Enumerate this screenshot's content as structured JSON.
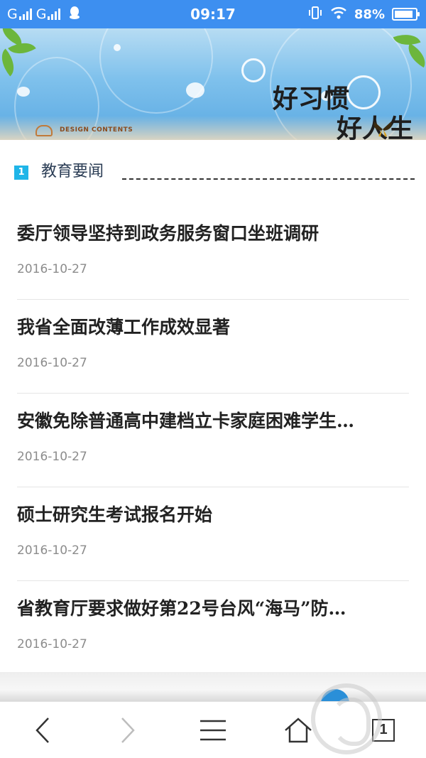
{
  "status_bar": {
    "carrier1": "G",
    "carrier2": "G",
    "time": "09:17",
    "battery": "88%",
    "battery_level": 0.88,
    "icons": [
      "signal-icon",
      "signal-icon",
      "qq-notification-icon",
      "vibrate-icon",
      "wifi-icon",
      "battery-icon"
    ]
  },
  "banner": {
    "slogan_line1": "好习惯",
    "slogan_line2": "好人生",
    "design_text": "DESIGN CONTENTS"
  },
  "section": {
    "number": "1",
    "title": "教育要闻"
  },
  "news": [
    {
      "title": "委厅领导坚持到政务服务窗口坐班调研",
      "date": "2016-10-27"
    },
    {
      "title": "我省全面改薄工作成效显著",
      "date": "2016-10-27"
    },
    {
      "title": "安徽免除普通高中建档立卡家庭困难学生…",
      "date": "2016-10-27"
    },
    {
      "title": "硕士研究生考试报名开始",
      "date": "2016-10-27"
    },
    {
      "title": "省教育厅要求做好第22号台风“海马”防…",
      "date": "2016-10-27"
    }
  ],
  "nav": {
    "tab_count": "1",
    "icons": [
      "back-arrow-icon",
      "forward-arrow-icon",
      "menu-icon",
      "home-icon",
      "tabs-icon"
    ]
  },
  "colors": {
    "status_bar": "#3d8ff0",
    "section_badge": "#1fb5e8",
    "title_text": "#222222",
    "date_text": "#8c8c8c"
  }
}
